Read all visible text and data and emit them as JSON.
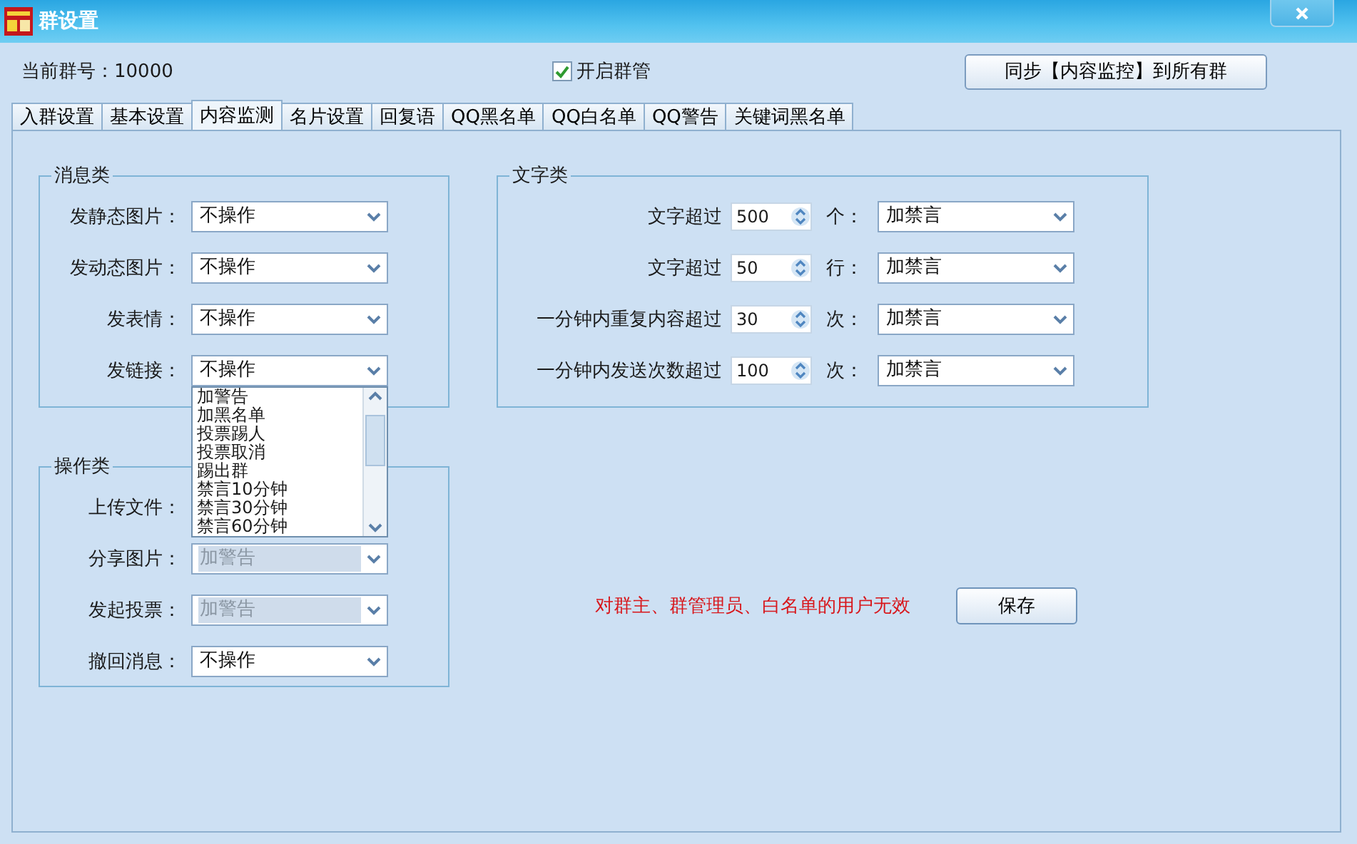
{
  "window": {
    "title": "群设置"
  },
  "header": {
    "group_number": "当前群号：10000",
    "enable_checkbox": {
      "label": "开启群管",
      "checked": true
    },
    "sync_button": "同步【内容监控】到所有群"
  },
  "tabs": [
    {
      "label": "入群设置",
      "selected": false
    },
    {
      "label": "基本设置",
      "selected": false
    },
    {
      "label": "内容监测",
      "selected": true
    },
    {
      "label": "名片设置",
      "selected": false
    },
    {
      "label": "回复语",
      "selected": false
    },
    {
      "label": "QQ黑名单",
      "selected": false
    },
    {
      "label": "QQ白名单",
      "selected": false
    },
    {
      "label": "QQ警告",
      "selected": false
    },
    {
      "label": "关键词黑名单",
      "selected": false
    }
  ],
  "message_group": {
    "title": "消息类",
    "rows": [
      {
        "label": "发静态图片：",
        "value": "不操作",
        "disabled": false
      },
      {
        "label": "发动态图片：",
        "value": "不操作",
        "disabled": false
      },
      {
        "label": "发表情：",
        "value": "不操作",
        "disabled": false
      },
      {
        "label": "发链接：",
        "value": "不操作",
        "disabled": false
      }
    ]
  },
  "open_dropdown": {
    "items": [
      "加警告",
      "加黑名单",
      "投票踢人",
      "投票取消",
      "踢出群",
      "禁言10分钟",
      "禁言30分钟",
      "禁言60分钟"
    ]
  },
  "operation_group": {
    "title": "操作类",
    "rows": [
      {
        "label": "上传文件："
      },
      {
        "label": "分享图片：",
        "value": "加警告",
        "disabled": true
      },
      {
        "label": "发起投票：",
        "value": "加警告",
        "disabled": true
      },
      {
        "label": "撤回消息：",
        "value": "不操作",
        "disabled": false
      }
    ]
  },
  "text_group": {
    "title": "文字类",
    "rows": [
      {
        "label": "文字超过",
        "number": "500",
        "unit": "个：",
        "value": "加禁言"
      },
      {
        "label": "文字超过",
        "number": "50",
        "unit": "行：",
        "value": "加禁言"
      },
      {
        "label": "一分钟内重复内容超过",
        "number": "30",
        "unit": "次：",
        "value": "加禁言"
      },
      {
        "label": "一分钟内发送次数超过",
        "number": "100",
        "unit": "次：",
        "value": "加禁言"
      }
    ]
  },
  "notice": "对群主、群管理员、白名单的用户无效",
  "save_button": "保存"
}
